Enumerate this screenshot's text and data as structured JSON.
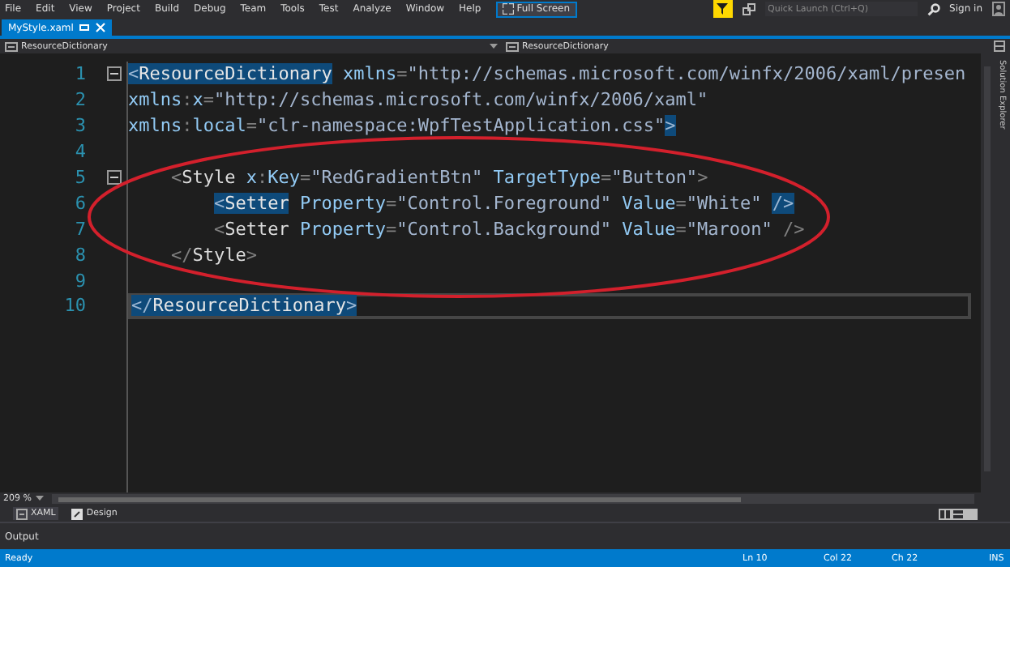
{
  "menu_bar": {
    "items": [
      "File",
      "Edit",
      "View",
      "Project",
      "Build",
      "Debug",
      "Team",
      "Tools",
      "Test",
      "Analyze",
      "Window",
      "Help"
    ],
    "full_screen_button": "Full Screen",
    "quick_launch": {
      "placeholder": "Quick Launch (Ctrl+Q)"
    },
    "sign_in": "Sign in"
  },
  "document_tabs": [
    {
      "label": "MyStyle.xaml",
      "selected": true
    }
  ],
  "navigation_bar": {
    "left": "ResourceDictionary",
    "right": "ResourceDictionary"
  },
  "side_tab": "Solution Explorer",
  "editor": {
    "lines": [
      {
        "number": "1",
        "foldable": true,
        "current": false,
        "tokens": [
          {
            "kind": "punct",
            "text": "<",
            "highlighted": true
          },
          {
            "kind": "element",
            "text": "ResourceDictionary",
            "highlighted": true
          },
          {
            "kind": "attr",
            "text": " xmlns",
            "highlighted": false
          },
          {
            "kind": "punct",
            "text": "=",
            "highlighted": false
          },
          {
            "kind": "string",
            "text": "\"http://schemas.microsoft.com/winfx/2006/xaml/presen",
            "highlighted": false
          }
        ]
      },
      {
        "number": "2",
        "foldable": false,
        "current": false,
        "tokens": [
          {
            "kind": "attr",
            "text": "xmlns",
            "highlighted": false
          },
          {
            "kind": "punct",
            "text": ":",
            "highlighted": false
          },
          {
            "kind": "attr",
            "text": "x",
            "highlighted": false
          },
          {
            "kind": "punct",
            "text": "=",
            "highlighted": false
          },
          {
            "kind": "string",
            "text": "\"http://schemas.microsoft.com/winfx/2006/xaml\"",
            "highlighted": false
          }
        ]
      },
      {
        "number": "3",
        "foldable": false,
        "current": false,
        "tokens": [
          {
            "kind": "attr",
            "text": "xmlns",
            "highlighted": false
          },
          {
            "kind": "punct",
            "text": ":",
            "highlighted": false
          },
          {
            "kind": "attr",
            "text": "local",
            "highlighted": false
          },
          {
            "kind": "punct",
            "text": "=",
            "highlighted": false
          },
          {
            "kind": "string",
            "text": "\"clr-namespace:WpfTestApplication.css\"",
            "highlighted": false
          },
          {
            "kind": "punct",
            "text": ">",
            "highlighted": true
          }
        ]
      },
      {
        "number": "4",
        "foldable": false,
        "current": false
      },
      {
        "number": "5",
        "foldable": true,
        "current": false,
        "tokens": [
          {
            "kind": "punct",
            "text": "    <",
            "highlighted": false
          },
          {
            "kind": "element",
            "text": "Style",
            "highlighted": false
          },
          {
            "kind": "attr",
            "text": " x",
            "highlighted": false
          },
          {
            "kind": "punct",
            "text": ":",
            "highlighted": false
          },
          {
            "kind": "attr",
            "text": "Key",
            "highlighted": false
          },
          {
            "kind": "punct",
            "text": "=",
            "highlighted": false
          },
          {
            "kind": "string",
            "text": "\"RedGradientBtn\"",
            "highlighted": false
          },
          {
            "kind": "attr",
            "text": " TargetType",
            "highlighted": false
          },
          {
            "kind": "punct",
            "text": "=",
            "highlighted": false
          },
          {
            "kind": "string",
            "text": "\"Button\"",
            "highlighted": false
          },
          {
            "kind": "punct",
            "text": ">",
            "highlighted": false
          }
        ]
      },
      {
        "number": "6",
        "foldable": false,
        "current": false,
        "tokens": [
          {
            "kind": "punct",
            "text": "        <",
            "highlighted": true
          },
          {
            "kind": "element",
            "text": "Setter",
            "highlighted": true
          },
          {
            "kind": "attr",
            "text": " Property",
            "highlighted": false
          },
          {
            "kind": "punct",
            "text": "=",
            "highlighted": false
          },
          {
            "kind": "string",
            "text": "\"Control.Foreground\"",
            "highlighted": false
          },
          {
            "kind": "attr",
            "text": " Value",
            "highlighted": false
          },
          {
            "kind": "punct",
            "text": "=",
            "highlighted": false
          },
          {
            "kind": "string",
            "text": "\"White\"",
            "highlighted": false
          },
          {
            "kind": "punct",
            "text": " />",
            "highlighted": true
          }
        ]
      },
      {
        "number": "7",
        "foldable": false,
        "current": false,
        "tokens": [
          {
            "kind": "punct",
            "text": "        <",
            "highlighted": false
          },
          {
            "kind": "element",
            "text": "Setter",
            "highlighted": false
          },
          {
            "kind": "attr",
            "text": " Property",
            "highlighted": false
          },
          {
            "kind": "punct",
            "text": "=",
            "highlighted": false
          },
          {
            "kind": "string",
            "text": "\"Control.Background\"",
            "highlighted": false
          },
          {
            "kind": "attr",
            "text": " Value",
            "highlighted": false
          },
          {
            "kind": "punct",
            "text": "=",
            "highlighted": false
          },
          {
            "kind": "string",
            "text": "\"Maroon\"",
            "highlighted": false
          },
          {
            "kind": "punct",
            "text": " />",
            "highlighted": false
          }
        ]
      },
      {
        "number": "8",
        "foldable": false,
        "current": false,
        "tokens": [
          {
            "kind": "punct",
            "text": "    </",
            "highlighted": false
          },
          {
            "kind": "element",
            "text": "Style",
            "highlighted": false
          },
          {
            "kind": "punct",
            "text": ">",
            "highlighted": false
          }
        ]
      },
      {
        "number": "9",
        "foldable": false,
        "current": false
      },
      {
        "number": "10",
        "foldable": false,
        "current": true,
        "tokens": [
          {
            "kind": "punct",
            "text": "</",
            "highlighted": true
          },
          {
            "kind": "element",
            "text": "ResourceDictionary",
            "highlighted": true
          },
          {
            "kind": "punct",
            "text": ">",
            "highlighted": true
          }
        ]
      }
    ]
  },
  "zoom": "209 %",
  "view_tabs": [
    {
      "label": "XAML",
      "selected": true
    },
    {
      "label": "Design",
      "selected": false
    }
  ],
  "output_tab": "Output",
  "status_bar": {
    "message": "Ready",
    "line": "Ln 10",
    "column": "Col 22",
    "char": "Ch 22",
    "mode": "INS"
  }
}
